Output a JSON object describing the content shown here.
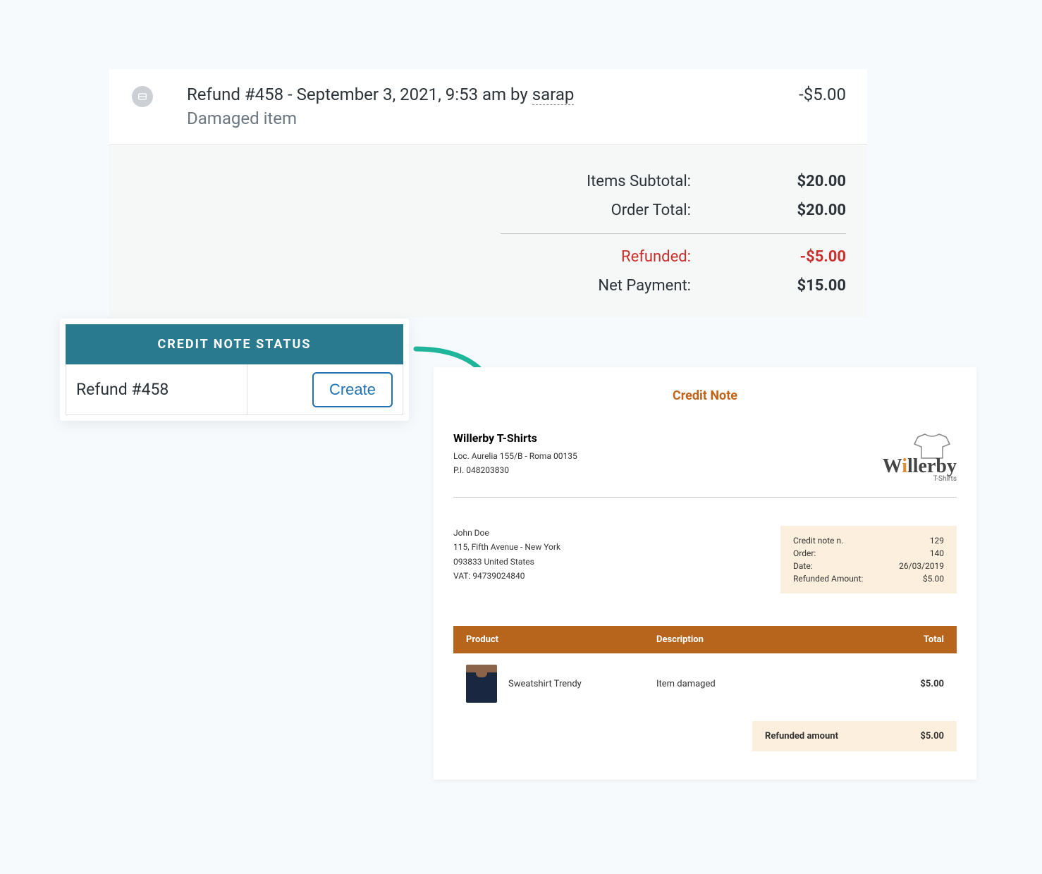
{
  "refund": {
    "title_prefix": "Refund #458 - September 3, 2021, 9:53 am by ",
    "user": "sarap",
    "reason": "Damaged item",
    "amount": "-$5.00"
  },
  "totals": {
    "subtotal_label": "Items Subtotal:",
    "subtotal_val": "$20.00",
    "order_label": "Order Total:",
    "order_val": "$20.00",
    "refunded_label": "Refunded:",
    "refunded_val": "-$5.00",
    "net_label": "Net Payment:",
    "net_val": "$15.00"
  },
  "status_panel": {
    "header": "CREDIT NOTE STATUS",
    "refund_label": "Refund #458",
    "create_label": "Create"
  },
  "credit_note": {
    "title": "Credit Note",
    "company": {
      "name": "Willerby T-Shirts",
      "address": "Loc. Aurelia 155/B - Roma 00135",
      "vat": "P.I. 048203830"
    },
    "logo": {
      "text_before": "W",
      "text_i": "i",
      "text_after": "llerby",
      "sub": "T-Shirts"
    },
    "customer": {
      "name": "John Doe",
      "address": "115, Fifth Avenue - New York",
      "zip_country": "093833 United States",
      "vat": "VAT: 94739024840"
    },
    "meta": {
      "credit_num_label": "Credit note n.",
      "credit_num": "129",
      "order_label": "Order:",
      "order": "140",
      "date_label": "Date:",
      "date": "26/03/2019",
      "refunded_label": "Refunded Amount:",
      "refunded": "$5.00"
    },
    "table": {
      "th_product": "Product",
      "th_desc": "Description",
      "th_total": "Total",
      "row": {
        "product": "Sweatshirt Trendy",
        "desc": "Item damaged",
        "total": "$5.00"
      }
    },
    "footer": {
      "label": "Refunded amount",
      "val": "$5.00"
    }
  }
}
